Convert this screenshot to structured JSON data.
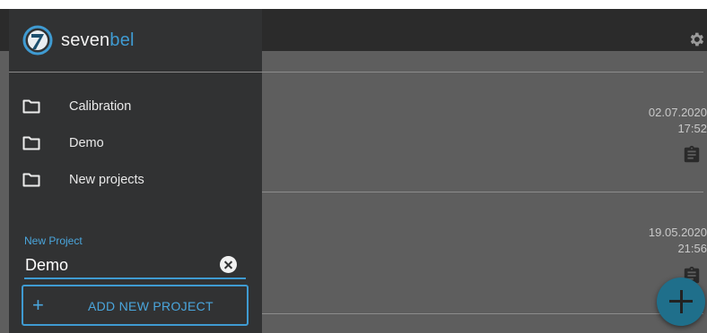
{
  "brand": {
    "name_part1": "seven",
    "name_part2": "bel",
    "accent": "#3f9bd2"
  },
  "drawer": {
    "items": [
      {
        "label": "Calibration",
        "icon": "folder-icon"
      },
      {
        "label": "Demo",
        "icon": "folder-icon"
      },
      {
        "label": "New projects",
        "icon": "folder-icon"
      }
    ],
    "new_project": {
      "label": "New Project",
      "value": "Demo",
      "clear_icon": "clear-icon"
    },
    "add_button": {
      "icon": "plus-icon",
      "label": "ADD NEW PROJECT"
    }
  },
  "app_bar": {
    "settings_icon": "gear-icon"
  },
  "projects": [
    {
      "date": "02.07.2020",
      "time": "17:52",
      "icon": "clipboard-icon"
    },
    {
      "date": "19.05.2020",
      "time": "21:56",
      "icon": "clipboard-icon"
    }
  ],
  "fab": {
    "icon": "plus-icon"
  }
}
